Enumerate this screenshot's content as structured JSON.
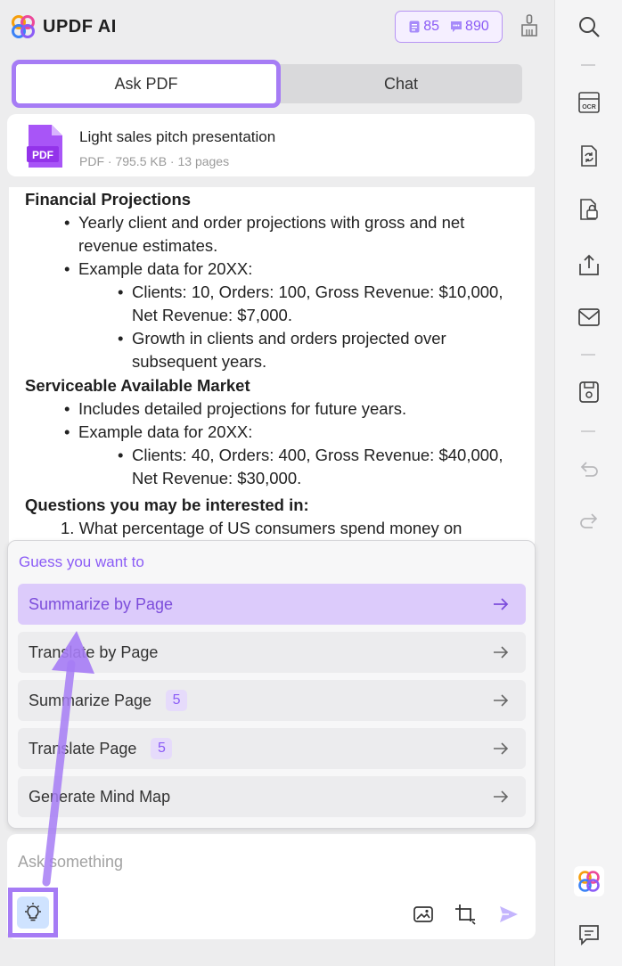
{
  "header": {
    "app_title": "UPDF AI",
    "credits": {
      "pdf_count": "85",
      "chat_count": "890"
    },
    "icons": {
      "logo": "updf-logo-icon",
      "credit_pdf": "document-icon",
      "credit_chat": "chat-bubble-icon",
      "clean": "brush-icon"
    }
  },
  "tabs": [
    {
      "label": "Ask PDF",
      "active": true
    },
    {
      "label": "Chat",
      "active": false
    }
  ],
  "file": {
    "name": "Light sales pitch presentation",
    "meta": "PDF · 795.5 KB · 13 pages",
    "icon_label": "PDF"
  },
  "content": {
    "sections": [
      {
        "heading": "Financial Projections",
        "items": [
          {
            "text": "Yearly client and order projections with gross and net revenue estimates.",
            "sub": []
          },
          {
            "text": "Example data for 20XX:",
            "sub": [
              "Clients: 10, Orders: 100, Gross Revenue: $10,000, Net Revenue: $7,000.",
              "Growth in clients and orders projected over subsequent years."
            ]
          }
        ]
      },
      {
        "heading": "Serviceable Available Market",
        "items": [
          {
            "text": "Includes detailed projections for future years.",
            "sub": []
          },
          {
            "text": "Example data for 20XX:",
            "sub": [
              "Clients: 40, Orders: 400, Gross Revenue: $40,000, Net Revenue: $30,000."
            ]
          }
        ]
      }
    ],
    "questions_heading": "Questions you may be interested in:",
    "question_1": "1. What percentage of US consumers spend money on"
  },
  "suggestions": {
    "title": "Guess you want to",
    "items": [
      {
        "label": "Summarize by Page",
        "badge": "",
        "active": true
      },
      {
        "label": "Translate by Page",
        "badge": "",
        "active": false
      },
      {
        "label": "Summarize Page",
        "badge": "5",
        "active": false
      },
      {
        "label": "Translate Page",
        "badge": "5",
        "active": false
      },
      {
        "label": "Generate Mind Map",
        "badge": "",
        "active": false
      }
    ]
  },
  "input": {
    "placeholder": "Ask something",
    "icons": [
      "lightbulb-icon",
      "image-icon",
      "crop-icon",
      "send-icon"
    ]
  },
  "rail_icons": [
    "search-icon",
    "ocr-icon",
    "convert-icon",
    "protect-icon",
    "share-icon",
    "email-icon",
    "save-icon",
    "undo-icon",
    "redo-icon",
    "updf-ai-icon",
    "comment-icon"
  ],
  "colors": {
    "accent": "#a67cf5",
    "accent_text": "#8b5cf6"
  }
}
